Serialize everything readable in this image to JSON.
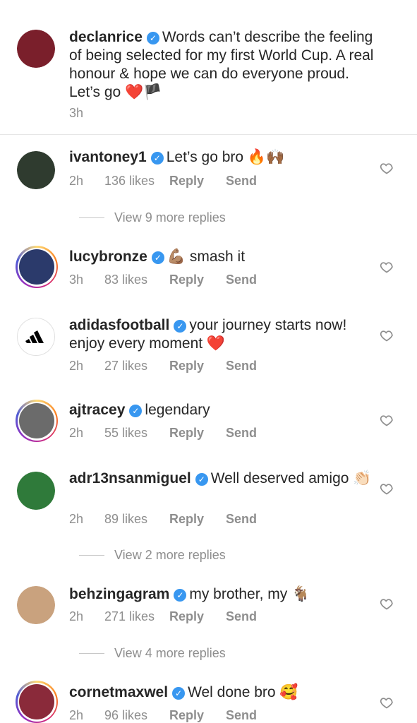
{
  "post": {
    "username": "declanrice",
    "caption": "Words can’t describe the feeling of being selected for my first World Cup. A real honour & hope we can do everyone proud. Let’s go ❤️🏴",
    "time": "3h",
    "avatar_color": "#7a1f2b"
  },
  "comments": [
    {
      "username": "ivantoney1",
      "text": "Let’s go bro 🔥🙌🏾",
      "time": "2h",
      "likes": "136 likes",
      "reply": "Reply",
      "send": "Send",
      "more": "View 9 more replies",
      "avatar_color": "#2f3b2f"
    },
    {
      "username": "lucybronze",
      "text": "💪🏽 smash it",
      "time": "3h",
      "likes": "83 likes",
      "reply": "Reply",
      "send": "Send",
      "avatar_color": "#2b3a6b"
    },
    {
      "username": "adidasfootball",
      "text": "your journey starts now! enjoy every moment ❤️",
      "time": "2h",
      "likes": "27 likes",
      "reply": "Reply",
      "send": "Send",
      "avatar_color": "#ffffff"
    },
    {
      "username": "ajtracey",
      "text": "legendary",
      "time": "2h",
      "likes": "55 likes",
      "reply": "Reply",
      "send": "Send",
      "avatar_color": "#6b6b6b"
    },
    {
      "username": "adr13nsanmiguel",
      "text": "Well deserved amigo 👏🏻",
      "time": "2h",
      "likes": "89 likes",
      "reply": "Reply",
      "send": "Send",
      "more": "View 2 more replies",
      "avatar_color": "#2f7a3a"
    },
    {
      "username": "behzingagram",
      "text": "my brother, my 🐐",
      "time": "2h",
      "likes": "271 likes",
      "reply": "Reply",
      "send": "Send",
      "more": "View 4 more replies",
      "avatar_color": "#c9a27e"
    },
    {
      "username": "cornetmaxwel",
      "text": "Wel done bro 🥰",
      "time": "2h",
      "likes": "96 likes",
      "reply": "Reply",
      "send": "Send",
      "avatar_color": "#8a2a3a"
    }
  ]
}
